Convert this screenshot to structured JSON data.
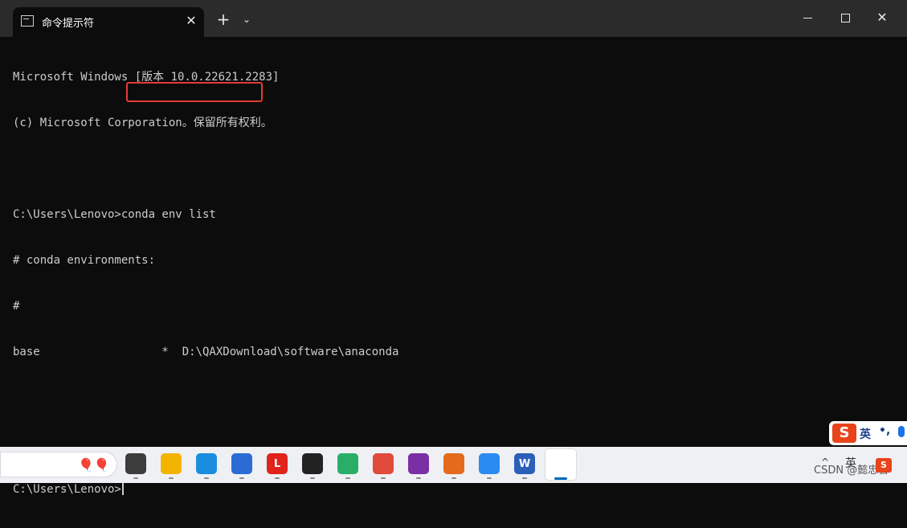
{
  "window": {
    "tab_title": "命令提示符",
    "tab_close": "✕",
    "new_tab": "+",
    "dropdown": "⌄",
    "close": "✕"
  },
  "console": {
    "lines": [
      "Microsoft Windows [版本 10.0.22621.2283]",
      "(c) Microsoft Corporation。保留所有权利。",
      "",
      "C:\\Users\\Lenovo>conda env list",
      "# conda environments:",
      "#",
      "base                  *  D:\\QAXDownload\\software\\anaconda",
      "",
      "",
      "C:\\Users\\Lenovo>"
    ]
  },
  "ime": {
    "logo": "S",
    "mode": "英",
    "punct": "•,"
  },
  "taskbar": {
    "apps": [
      {
        "name": "task-view-icon",
        "color": "#3c3c3c",
        "label": ""
      },
      {
        "name": "file-explorer-icon",
        "color": "#f3b400",
        "label": ""
      },
      {
        "name": "edge-icon",
        "color": "#1b8de0",
        "label": ""
      },
      {
        "name": "store-icon",
        "color": "#2b6cd4",
        "label": ""
      },
      {
        "name": "app-l-icon",
        "color": "#e0231b",
        "label": "L"
      },
      {
        "name": "qq-icon",
        "color": "#222222",
        "label": ""
      },
      {
        "name": "wechat-icon",
        "color": "#2aae67",
        "label": ""
      },
      {
        "name": "chrome-icon",
        "color": "#e04a3b",
        "label": ""
      },
      {
        "name": "pdf-icon",
        "color": "#7a2fa5",
        "label": ""
      },
      {
        "name": "matlab-icon",
        "color": "#e46b1c",
        "label": ""
      },
      {
        "name": "baidu-netdisk-icon",
        "color": "#2a8cf0",
        "label": ""
      },
      {
        "name": "word-icon",
        "color": "#2b5fb8",
        "label": "W"
      },
      {
        "name": "terminal-icon",
        "color": "#2b2b2b",
        "label": ">_"
      }
    ],
    "tray_chevron": "^",
    "tray_ime": "英",
    "watermark": "CSDN @懿忠哲",
    "tray_sg": "S"
  }
}
